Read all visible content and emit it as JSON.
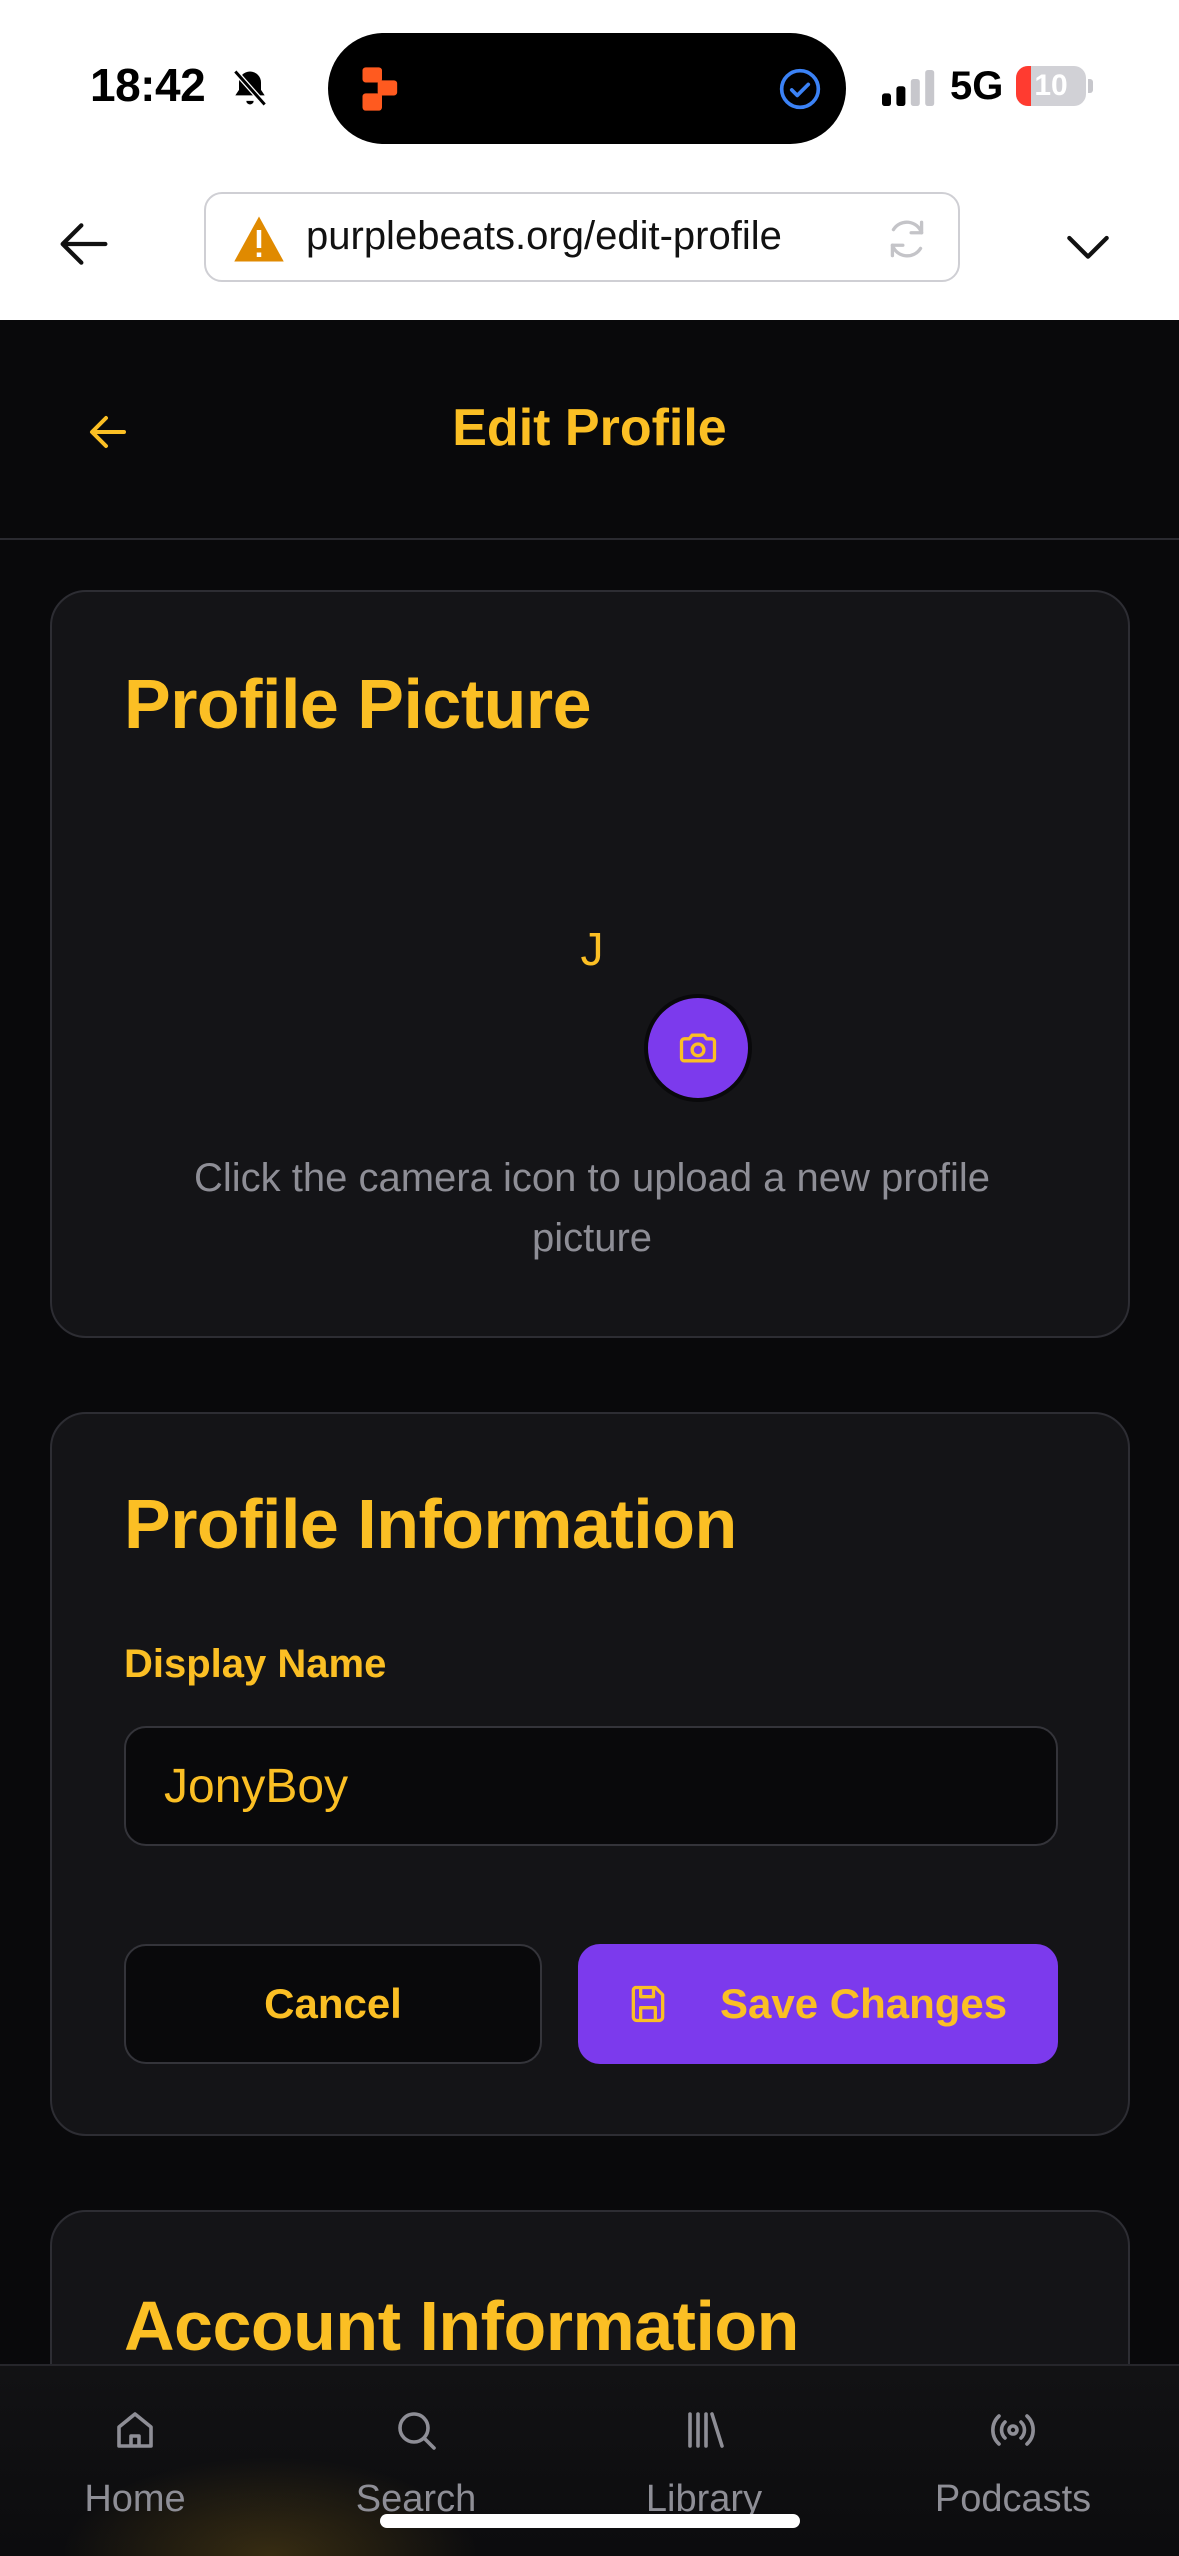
{
  "status_bar": {
    "time": "18:42",
    "network": "5G",
    "battery_level": "10",
    "battery_fraction": 0.1,
    "icons": [
      "bell-slash-icon",
      "app-icon",
      "checkmark-circle-icon",
      "signal-icon"
    ]
  },
  "browser": {
    "url": "purplebeats.org/edit-profile",
    "icons": [
      "back-arrow-icon",
      "warning-icon",
      "reload-icon",
      "chevron-down-icon"
    ]
  },
  "header": {
    "title": "Edit Profile"
  },
  "profile_picture": {
    "title": "Profile Picture",
    "avatar_initial": "J",
    "hint": "Click the camera icon to upload a new profile picture"
  },
  "profile_info": {
    "title": "Profile Information",
    "display_name_label": "Display Name",
    "display_name_value": "JonyBoy",
    "cancel_label": "Cancel",
    "save_label": "Save Changes"
  },
  "account_info": {
    "title": "Account Information"
  },
  "nav": {
    "items": [
      {
        "label": "Home",
        "icon": "home-icon"
      },
      {
        "label": "Search",
        "icon": "search-icon"
      },
      {
        "label": "Library",
        "icon": "library-icon"
      },
      {
        "label": "Podcasts",
        "icon": "podcast-icon"
      }
    ]
  },
  "colors": {
    "accent": "#fbbf24",
    "primary": "#7c3aed",
    "background": "#09090b",
    "card": "#141417",
    "muted_text": "#8e8e96"
  }
}
